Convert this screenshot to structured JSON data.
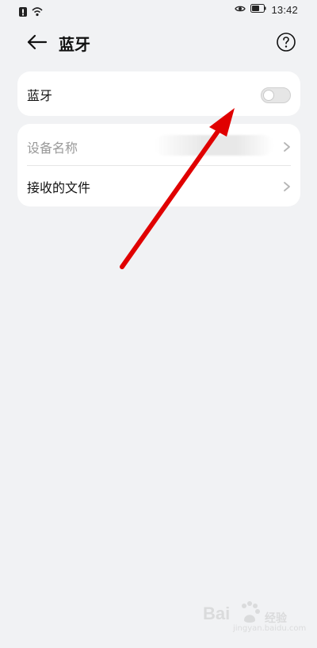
{
  "status_bar": {
    "time": "13:42",
    "icons": [
      "alert-icon",
      "wifi-icon",
      "eye-icon",
      "battery-icon"
    ]
  },
  "header": {
    "title": "蓝牙",
    "back_icon": "arrow-left-icon",
    "help_icon": "question-circle-icon"
  },
  "bluetooth": {
    "label": "蓝牙",
    "enabled": false
  },
  "settings": {
    "device_name_label": "设备名称",
    "received_files_label": "接收的文件"
  },
  "watermark": {
    "brand": "Bai",
    "suffix": "经验",
    "sub": "jingyan.baidu.com"
  },
  "colors": {
    "background": "#f1f2f4",
    "card": "#ffffff",
    "muted_text": "#999999",
    "annotation_arrow": "#e00000"
  }
}
